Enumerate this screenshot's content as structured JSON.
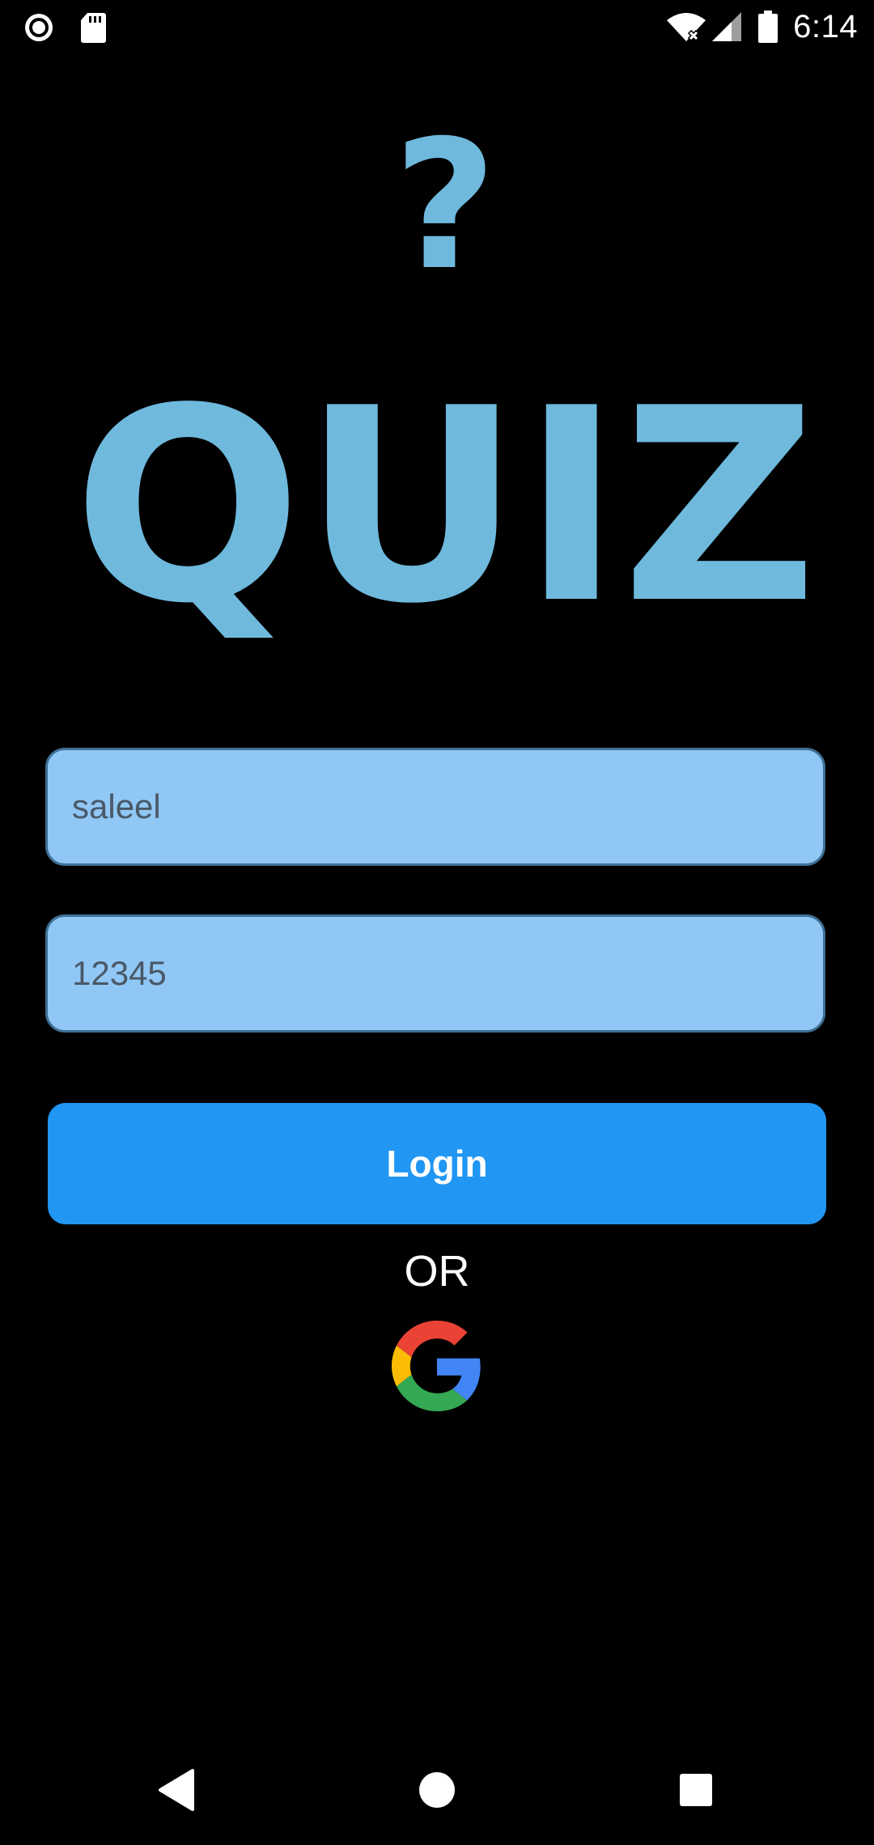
{
  "status_bar": {
    "time": "6:14",
    "left_icons": [
      "record-icon",
      "sd-card-icon"
    ],
    "right_icons": [
      "wifi-no-internet-icon",
      "cell-signal-icon",
      "battery-icon"
    ]
  },
  "logo": {
    "text": "QUIZ",
    "mark": "?",
    "color": "#6fb9dd"
  },
  "form": {
    "username_value": "saleel",
    "password_value": "12345",
    "login_label": "Login",
    "or_label": "OR",
    "google_icon": "google-g-icon"
  },
  "colors": {
    "background": "#000000",
    "input_fill": "#90c7f5",
    "button_fill": "#2196f3"
  },
  "nav_bar": {
    "icons": [
      "back-icon",
      "home-icon",
      "recents-icon"
    ]
  }
}
